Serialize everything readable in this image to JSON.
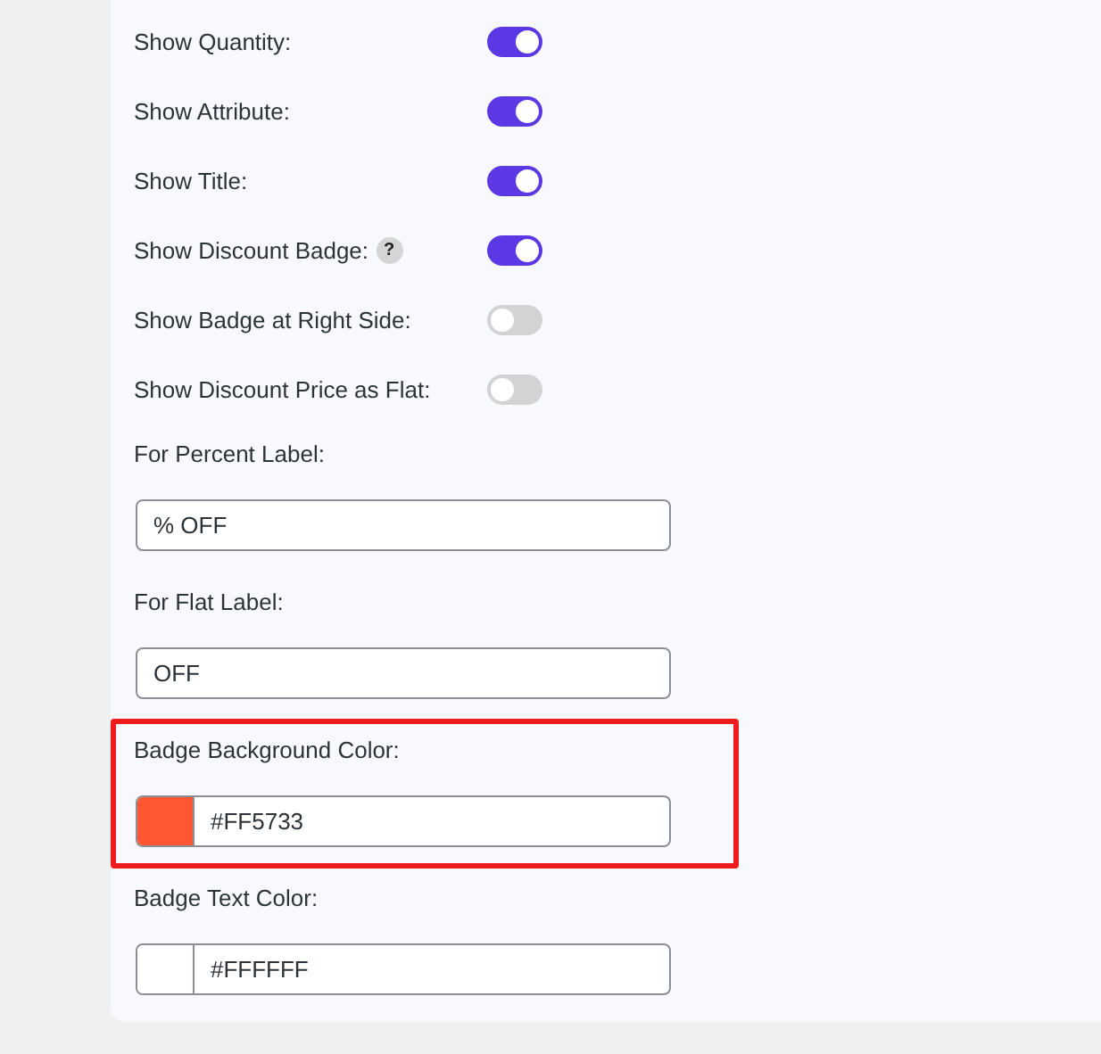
{
  "toggles": [
    {
      "label": "Show Quantity:",
      "on": true
    },
    {
      "label": "Show Attribute:",
      "on": true
    },
    {
      "label": "Show Title:",
      "on": true
    },
    {
      "label": "Show Discount Badge:",
      "help": "?",
      "on": true
    },
    {
      "label": "Show Badge at Right Side:",
      "on": false
    },
    {
      "label": "Show Discount Price as Flat:",
      "on": false
    }
  ],
  "fields": [
    {
      "kind": "text",
      "label": "For Percent Label:",
      "value": "% OFF",
      "highlighted": false
    },
    {
      "kind": "text",
      "label": "For Flat Label:",
      "value": "OFF",
      "highlighted": false
    },
    {
      "kind": "color",
      "label": "Badge Background Color:",
      "value": "#FF5733",
      "color": "#ff5733",
      "highlighted": true
    },
    {
      "kind": "color",
      "label": "Badge Text Color:",
      "value": "#FFFFFF",
      "color": "#ffffff",
      "highlighted": false
    }
  ]
}
